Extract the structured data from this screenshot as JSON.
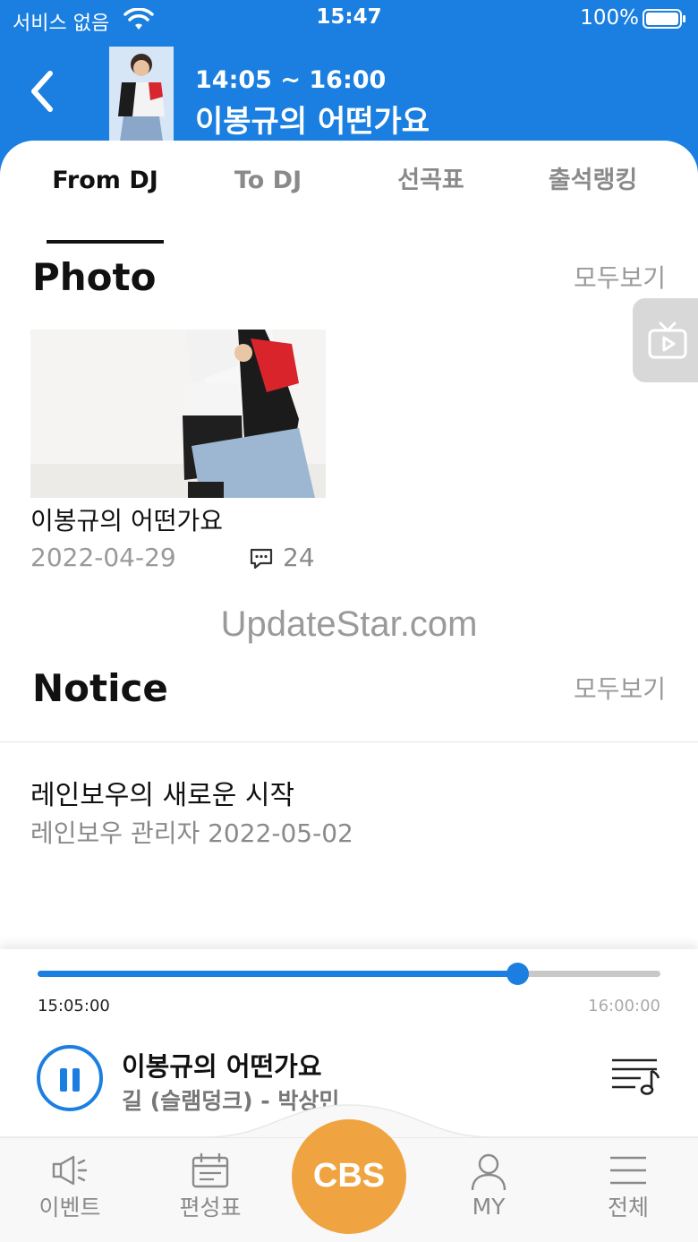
{
  "status_bar": {
    "carrier": "서비스 없음",
    "time": "15:47",
    "battery": "100%"
  },
  "header": {
    "time_range": "14:05 ~ 16:00",
    "program_title": "이봉규의 어떤가요"
  },
  "tabs": [
    {
      "label": "From DJ",
      "active": true
    },
    {
      "label": "To DJ",
      "active": false
    },
    {
      "label": "선곡표",
      "active": false
    },
    {
      "label": "출석랭킹",
      "active": false
    }
  ],
  "photo_section": {
    "title": "Photo",
    "see_all": "모두보기",
    "items": [
      {
        "caption": "이봉규의 어떤가요",
        "date": "2022-04-29",
        "comments": "24"
      }
    ]
  },
  "watermark": "UpdateStar.com",
  "notice_section": {
    "title": "Notice",
    "see_all": "모두보기",
    "items": [
      {
        "title": "레인보우의 새로운 시작",
        "meta": "레인보우 관리자  2022-05-02"
      }
    ]
  },
  "player": {
    "progress": 0.77,
    "start_time": "15:05:00",
    "end_time": "16:00:00",
    "title": "이봉규의 어떤가요",
    "song": "길 (슬램덩크) - 박상민"
  },
  "bottom_nav": {
    "items": [
      {
        "label": "이벤트",
        "icon": "speaker-icon"
      },
      {
        "label": "편성표",
        "icon": "calendar-icon"
      },
      {
        "label": "CBS",
        "icon": "cbs-logo"
      },
      {
        "label": "MY",
        "icon": "person-icon"
      },
      {
        "label": "전체",
        "icon": "menu-icon"
      }
    ]
  },
  "colors": {
    "primary": "#1a7fe0",
    "accent": "#f0a441"
  }
}
